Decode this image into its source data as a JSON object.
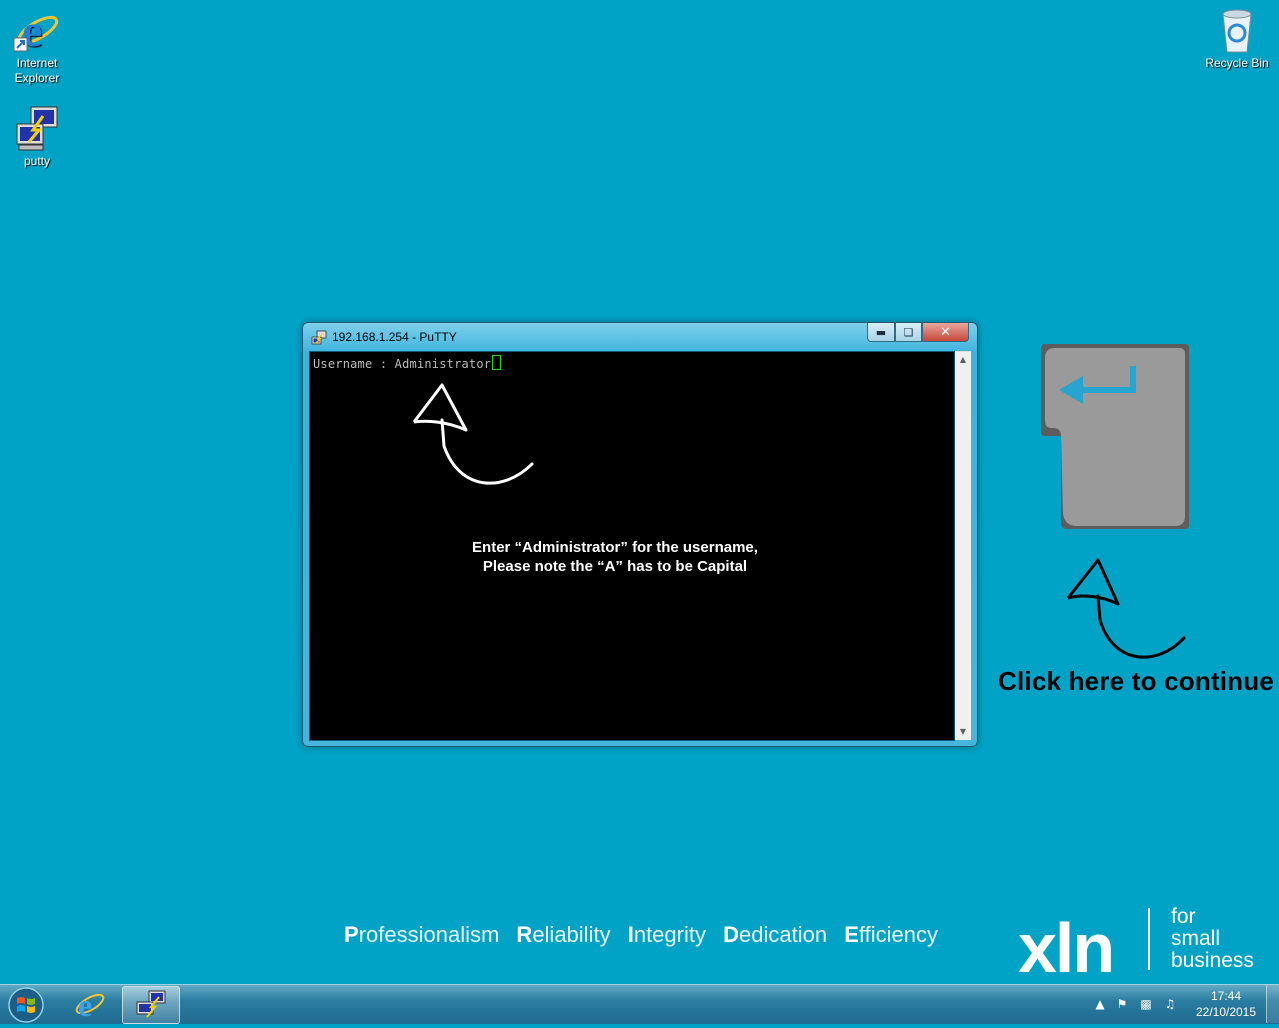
{
  "desktop": {
    "icons": [
      {
        "label": "Internet\nExplorer"
      },
      {
        "label": "putty"
      },
      {
        "label": "Recycle Bin"
      }
    ]
  },
  "putty": {
    "title": "192.168.1.254 - PuTTY",
    "terminal_line": "Username : Administrator",
    "note": "Enter “Administrator” for the username,\nPlease note the “A” has to be Capital"
  },
  "continue_text": "Click here to continue",
  "values": [
    {
      "initial": "P",
      "rest": "rofessionalism"
    },
    {
      "initial": "R",
      "rest": "eliability"
    },
    {
      "initial": "I",
      "rest": "ntegrity"
    },
    {
      "initial": "D",
      "rest": "edication"
    },
    {
      "initial": "E",
      "rest": "fficiency"
    }
  ],
  "brand": {
    "name": "xln",
    "tagline": "for\nsmall\nbusiness"
  },
  "taskbar": {
    "time": "17:44",
    "date": "22/10/2015"
  },
  "colors": {
    "desktop": "#00a3c6",
    "accent_arrow": "#27a5d1",
    "cursor": "#21d321"
  }
}
